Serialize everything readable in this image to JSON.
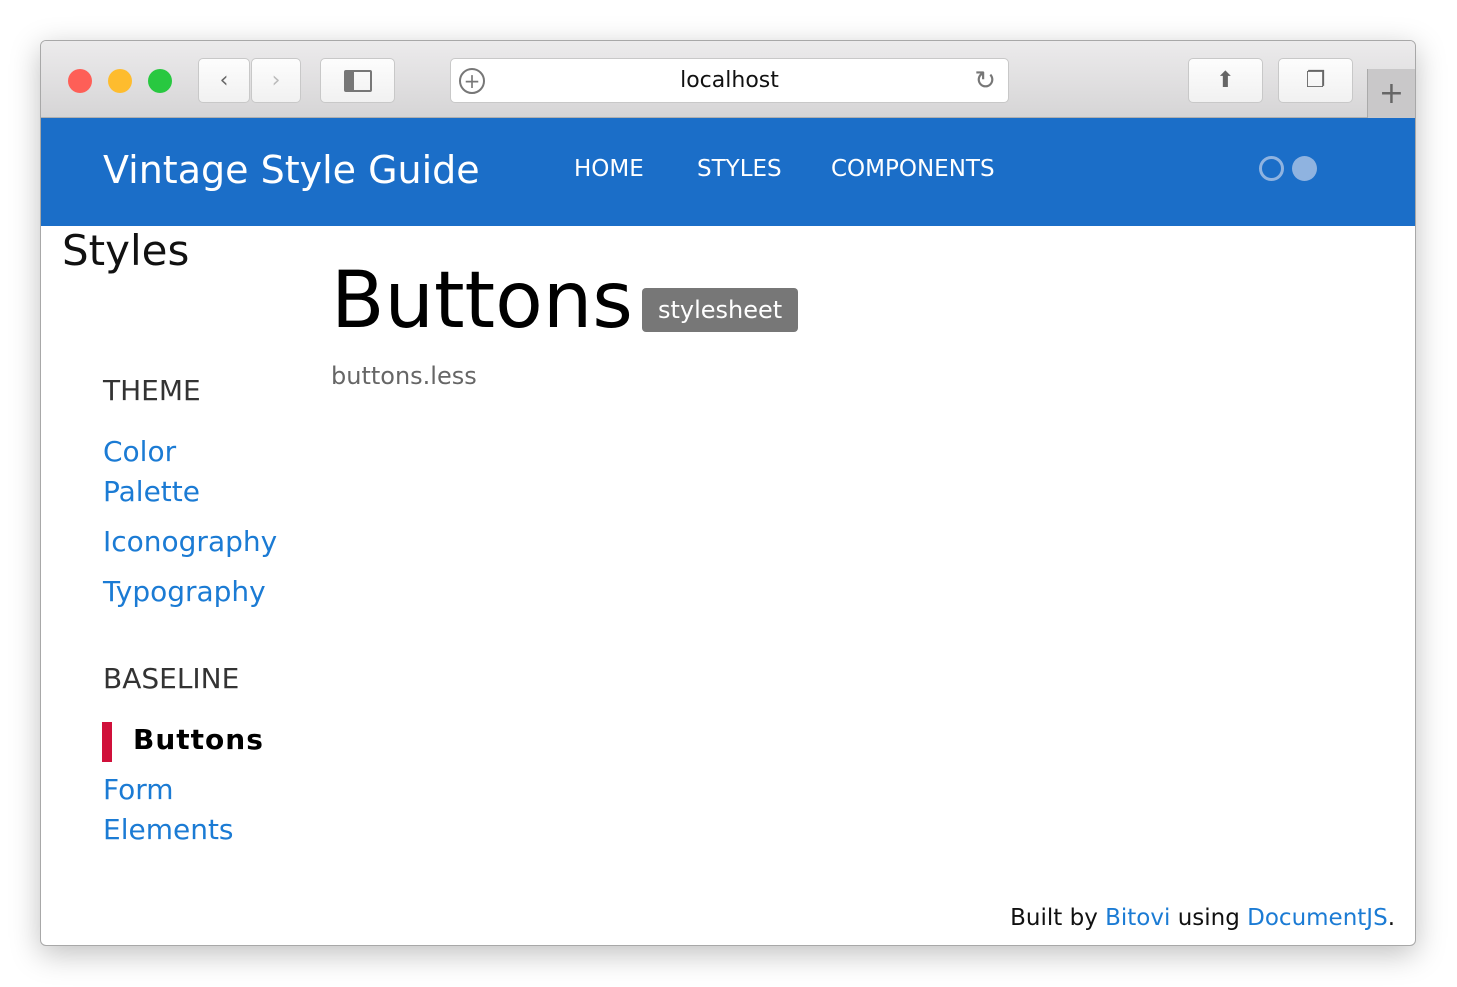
{
  "browser": {
    "url": "localhost",
    "colors": {
      "close": "#fe5f57",
      "minimize": "#febc2e",
      "maximize": "#28c840"
    }
  },
  "nav": {
    "brand": "Vintage Style Guide",
    "links": [
      "HOME",
      "STYLES",
      "COMPONENTS"
    ],
    "accent": "#1b6ec8"
  },
  "sidebar": {
    "title": "Styles",
    "sections": [
      {
        "heading": "THEME",
        "items": [
          "Color Palette",
          "Iconography",
          "Typography"
        ]
      },
      {
        "heading": "BASELINE",
        "items": [
          "Buttons",
          "Form Elements"
        ]
      }
    ],
    "active": "Buttons",
    "active_color": "#d0103a"
  },
  "main": {
    "title": "Buttons",
    "badge": "stylesheet",
    "file": "buttons.less"
  },
  "footer": {
    "prefix": "Built by ",
    "bitovi": "Bitovi",
    "middle": " using ",
    "documentjs": "DocumentJS",
    "suffix": "."
  }
}
